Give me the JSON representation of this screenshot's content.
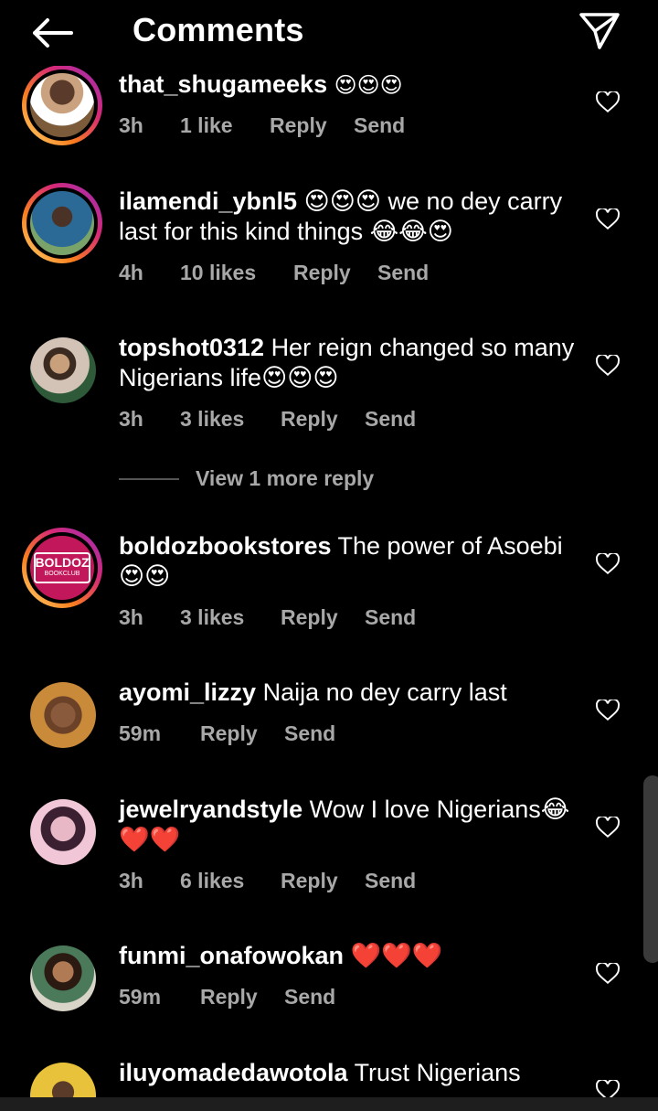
{
  "header": {
    "title": "Comments",
    "back_icon": "arrow-left-icon",
    "send_icon": "paper-plane-icon"
  },
  "comments": [
    {
      "username": "that_shugameeks",
      "text": "",
      "emoji": "😍😍😍",
      "time": "3h",
      "likes": "1 like",
      "reply": "Reply",
      "send": "Send"
    },
    {
      "username": "ilamendi_ybnl5",
      "text": "😍😍😍 we no dey carry last for this kind things 😂😂😍",
      "time": "4h",
      "likes": "10 likes",
      "reply": "Reply",
      "send": "Send"
    },
    {
      "username": "topshot0312",
      "text": "Her reign changed so many Nigerians life😍😍😍",
      "time": "3h",
      "likes": "3 likes",
      "reply": "Reply",
      "send": "Send"
    },
    {
      "username": "boldozbookstores",
      "text": "The power of Asoebi 😍😍",
      "time": "3h",
      "likes": "3 likes",
      "reply": "Reply",
      "send": "Send",
      "avatar_text": "BOLDOZ",
      "avatar_sub": "BOOKCLUB"
    },
    {
      "username": "ayomi_lizzy",
      "text": "Naija no dey carry last",
      "time": "59m",
      "likes": "",
      "reply": "Reply",
      "send": "Send"
    },
    {
      "username": "jewelryandstyle",
      "text": "Wow I love Nigerians😂 ❤️❤️",
      "time": "3h",
      "likes": "6 likes",
      "reply": "Reply",
      "send": "Send"
    },
    {
      "username": "funmi_onafowokan",
      "text": "❤️❤️❤️",
      "time": "59m",
      "likes": "",
      "reply": "Reply",
      "send": "Send"
    },
    {
      "username": "iluyomadedawotola",
      "text": "Trust Nigerians",
      "time": "",
      "likes": "",
      "reply": "",
      "send": ""
    }
  ],
  "view_more": "View 1 more reply",
  "colors": {
    "ring_start": "#feda75",
    "ring_end": "#962fbf",
    "meta": "#a8a8a8",
    "background": "#000000"
  }
}
